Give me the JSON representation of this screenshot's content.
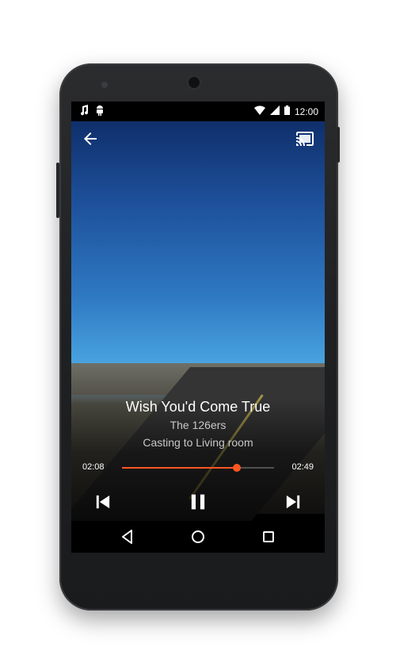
{
  "status_bar": {
    "time": "12:00",
    "left_icons": [
      "music-note-icon",
      "android-icon"
    ],
    "right_icons": [
      "wifi-icon",
      "signal-icon",
      "battery-icon"
    ]
  },
  "top_bar": {
    "back_icon": "arrow-back-icon",
    "cast_icon": "cast-icon"
  },
  "now_playing": {
    "title": "Wish You'd Come True",
    "artist": "The 126ers",
    "casting": "Casting to Living room"
  },
  "progress": {
    "elapsed": "02:08",
    "total": "02:49",
    "fraction": 0.757,
    "accent": "#ff5722"
  },
  "controls": {
    "previous_icon": "skip-previous-icon",
    "pause_icon": "pause-icon",
    "next_icon": "skip-next-icon"
  },
  "nav_bar": {
    "back_icon": "nav-back-icon",
    "home_icon": "nav-home-icon",
    "recents_icon": "nav-recents-icon"
  }
}
